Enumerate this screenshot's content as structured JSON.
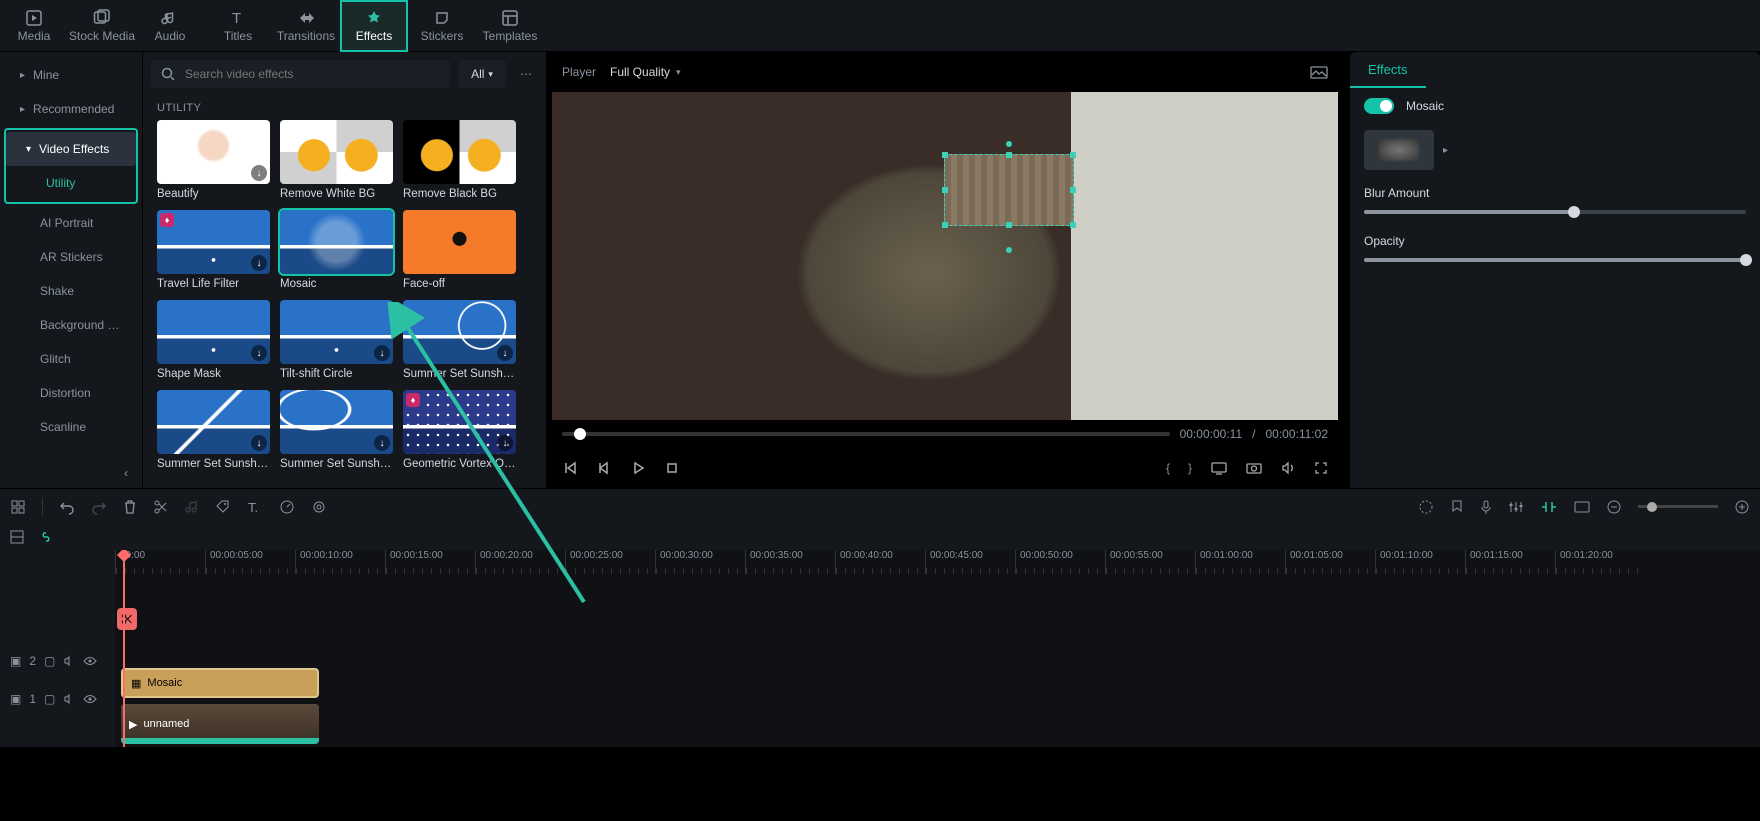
{
  "topbar": {
    "tabs": [
      {
        "label": "Media",
        "icon": "media"
      },
      {
        "label": "Stock Media",
        "icon": "stock"
      },
      {
        "label": "Audio",
        "icon": "audio"
      },
      {
        "label": "Titles",
        "icon": "titles"
      },
      {
        "label": "Transitions",
        "icon": "transitions"
      },
      {
        "label": "Effects",
        "icon": "effects",
        "active": true,
        "highlight": true
      },
      {
        "label": "Stickers",
        "icon": "stickers"
      },
      {
        "label": "Templates",
        "icon": "templates"
      }
    ]
  },
  "left": {
    "items": [
      {
        "label": "Mine",
        "type": "group"
      },
      {
        "label": "Recommended",
        "type": "group"
      }
    ],
    "highlight_group": {
      "header": "Video Effects",
      "child": "Utility"
    },
    "more": [
      {
        "label": "AI Portrait"
      },
      {
        "label": "AR Stickers"
      },
      {
        "label": "Shake"
      },
      {
        "label": "Background …"
      },
      {
        "label": "Glitch"
      },
      {
        "label": "Distortion"
      },
      {
        "label": "Scanline"
      }
    ],
    "back_icon": "chevron-left"
  },
  "search": {
    "placeholder": "Search video effects",
    "filter": "All"
  },
  "grid": {
    "section": "UTILITY",
    "items": [
      {
        "label": "Beautify",
        "type": "portrait",
        "dl": true
      },
      {
        "label": "Remove White BG",
        "type": "yellow-white"
      },
      {
        "label": "Remove Black BG",
        "type": "yellow-black"
      },
      {
        "label": "Travel Life Filter",
        "type": "lighthouse",
        "premium": true,
        "dl": true
      },
      {
        "label": "Mosaic",
        "type": "lighthouse-blur",
        "selected": true
      },
      {
        "label": "Face-off",
        "type": "orange-person"
      },
      {
        "label": "Shape Mask",
        "type": "lighthouse",
        "dl": true
      },
      {
        "label": "Tilt-shift Circle",
        "type": "lighthouse",
        "dl": true
      },
      {
        "label": "Summer Set Sunshine …",
        "type": "lighthouse-arc",
        "dl": true
      },
      {
        "label": "Summer Set Sunshine …",
        "type": "lighthouse-line",
        "dl": true
      },
      {
        "label": "Summer Set Sunshine …",
        "type": "lighthouse-curve",
        "dl": true
      },
      {
        "label": "Geometric Vortex Ove…",
        "type": "lighthouse-dots",
        "premium": true,
        "dl": true
      }
    ]
  },
  "player": {
    "label": "Player",
    "quality": "Full Quality",
    "current_time": "00:00:00:11",
    "separator": "/",
    "total_time": "00:00:11:02"
  },
  "rightpanel": {
    "tab": "Effects",
    "toggle_label": "Mosaic",
    "slider1": "Blur Amount",
    "slider1_pct": 55,
    "slider2": "Opacity",
    "slider2_pct": 100
  },
  "timeline": {
    "ruler": [
      "00:00",
      "00:00:05:00",
      "00:00:10:00",
      "00:00:15:00",
      "00:00:20:00",
      "00:00:25:00",
      "00:00:30:00",
      "00:00:35:00",
      "00:00:40:00",
      "00:00:45:00",
      "00:00:50:00",
      "00:00:55:00",
      "00:01:00:00",
      "00:01:05:00",
      "00:01:10:00",
      "00:01:15:00",
      "00:01:20:00"
    ],
    "tracks": {
      "fx_track": "2",
      "video_track": "1"
    },
    "clips": {
      "mosaic": "Mosaic",
      "video": "unnamed"
    }
  }
}
